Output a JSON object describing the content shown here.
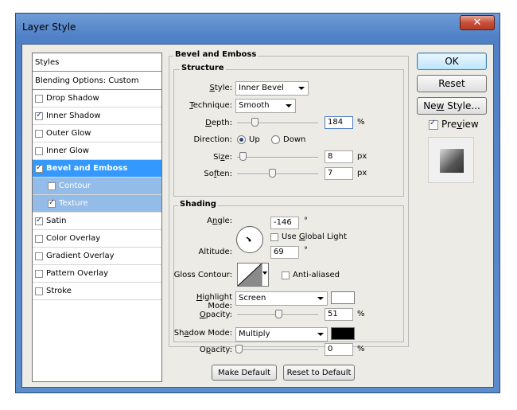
{
  "window": {
    "title": "Layer Style",
    "close_glyph": "✕"
  },
  "styles_list": {
    "header": "Styles",
    "blending": "Blending Options: Custom",
    "items": [
      {
        "label": "Drop Shadow",
        "checked": false
      },
      {
        "label": "Inner Shadow",
        "checked": true
      },
      {
        "label": "Outer Glow",
        "checked": false
      },
      {
        "label": "Inner Glow",
        "checked": false
      },
      {
        "label": "Bevel and Emboss",
        "checked": true,
        "selected": true
      },
      {
        "label": "Contour",
        "checked": false,
        "sub": true
      },
      {
        "label": "Texture",
        "checked": true,
        "sub": true
      },
      {
        "label": "Satin",
        "checked": true
      },
      {
        "label": "Color Overlay",
        "checked": false
      },
      {
        "label": "Gradient Overlay",
        "checked": false
      },
      {
        "label": "Pattern Overlay",
        "checked": false
      },
      {
        "label": "Stroke",
        "checked": false
      }
    ]
  },
  "bevel": {
    "section_title": "Bevel and Emboss",
    "structure_title": "Structure",
    "style_label": "Style:",
    "style_value": "Inner Bevel",
    "technique_label": "Technique:",
    "technique_value": "Smooth",
    "depth_label": "Depth:",
    "depth_value": "184",
    "depth_unit": "%",
    "direction_label": "Direction:",
    "direction_up": "Up",
    "direction_down": "Down",
    "size_label": "Size:",
    "size_value": "8",
    "size_unit": "px",
    "soften_label": "Soften:",
    "soften_value": "7",
    "soften_unit": "px"
  },
  "shading": {
    "title": "Shading",
    "angle_label": "Angle:",
    "angle_value": "-146",
    "angle_unit": "°",
    "use_global_light": "Use Global Light",
    "altitude_label": "Altitude:",
    "altitude_value": "69",
    "altitude_unit": "°",
    "gloss_label": "Gloss Contour:",
    "anti_aliased": "Anti-aliased",
    "highlight_mode_label": "Highlight Mode:",
    "highlight_mode_value": "Screen",
    "highlight_color": "#ffffff",
    "highlight_opacity_label": "Opacity:",
    "highlight_opacity_value": "51",
    "highlight_opacity_unit": "%",
    "shadow_mode_label": "Shadow Mode:",
    "shadow_mode_value": "Multiply",
    "shadow_color": "#000000",
    "shadow_opacity_label": "Opacity:",
    "shadow_opacity_value": "0",
    "shadow_opacity_unit": "%"
  },
  "buttons": {
    "make_default": "Make Default",
    "reset_default": "Reset to Default",
    "ok": "OK",
    "reset": "Reset",
    "new_style": "New Style...",
    "preview": "Preview"
  }
}
